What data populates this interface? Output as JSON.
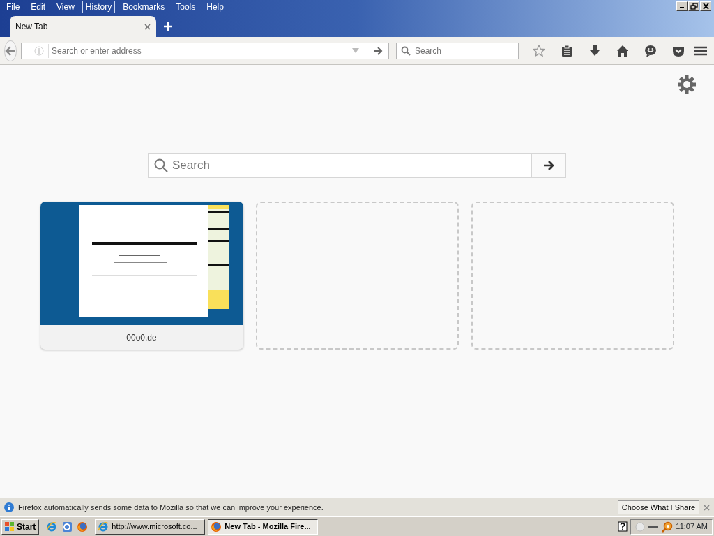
{
  "menu_bar": [
    {
      "label": "File",
      "selected": false
    },
    {
      "label": "Edit",
      "selected": false
    },
    {
      "label": "View",
      "selected": false
    },
    {
      "label": "History",
      "selected": true
    },
    {
      "label": "Bookmarks",
      "selected": false
    },
    {
      "label": "Tools",
      "selected": false
    },
    {
      "label": "Help",
      "selected": false
    }
  ],
  "tabs": [
    {
      "label": "New Tab",
      "selected": true
    }
  ],
  "address_bar": {
    "placeholder": "Search or enter address"
  },
  "search_bar": {
    "placeholder": "Search"
  },
  "page_search": {
    "placeholder": "Search"
  },
  "tiles": [
    {
      "kind": "site",
      "label": "00o0.de"
    },
    {
      "kind": "empty"
    },
    {
      "kind": "empty"
    }
  ],
  "notification": {
    "text": "Firefox automatically sends some data to Mozilla so that we can improve your experience.",
    "button": "Choose What I Share"
  },
  "taskbar": {
    "start": "Start",
    "tasks": [
      {
        "label": "http://www.microsoft.co...",
        "kind": "ie",
        "selected": false
      },
      {
        "label": "New Tab - Mozilla Fire...",
        "kind": "firefox",
        "selected": true
      }
    ],
    "clock": "11:07 AM"
  }
}
